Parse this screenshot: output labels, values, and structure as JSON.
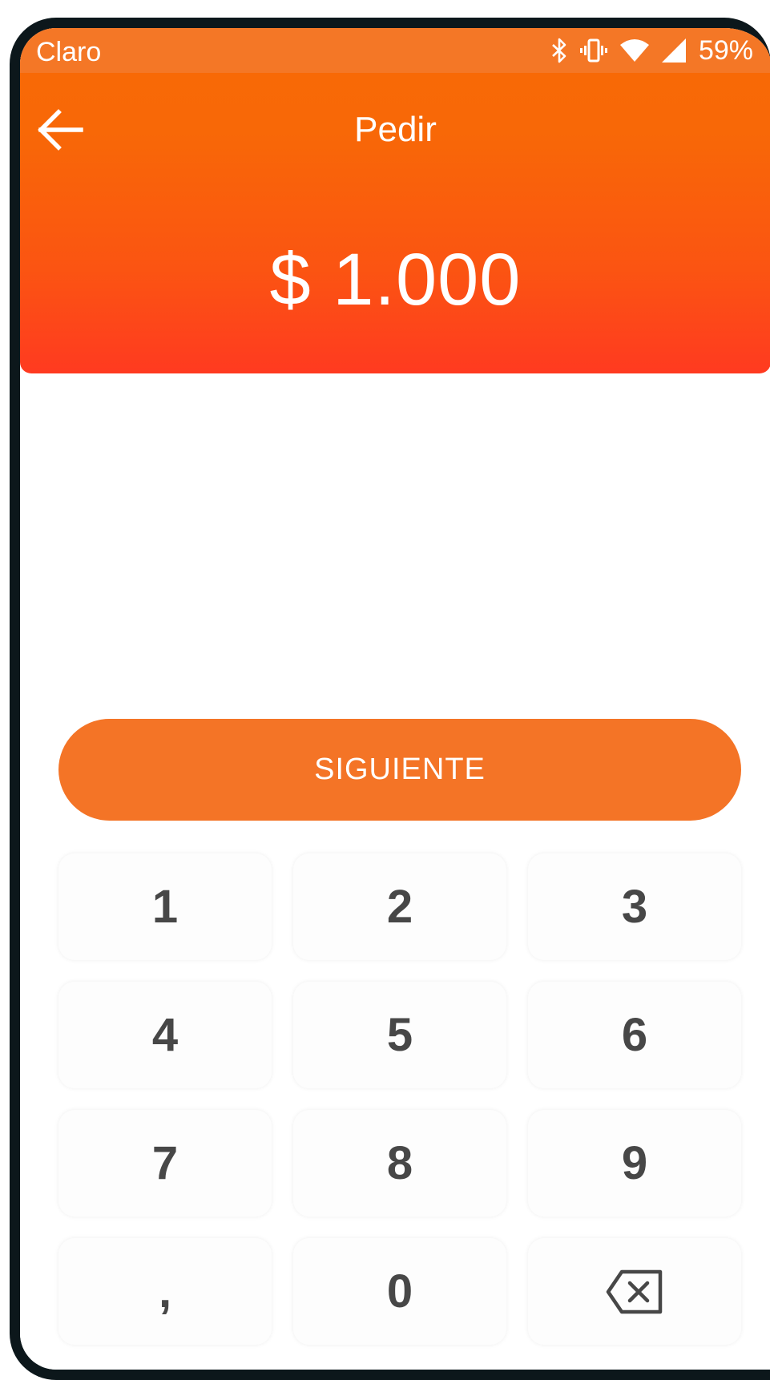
{
  "status_bar": {
    "carrier": "Claro",
    "battery": "59%",
    "icons": [
      "bluetooth-icon",
      "vibrate-icon",
      "wifi-icon",
      "signal-icon"
    ]
  },
  "header": {
    "title": "Pedir",
    "amount": "$ 1.000",
    "back_icon": "arrow-left-icon"
  },
  "actions": {
    "next_label": "SIGUIENTE"
  },
  "keypad": {
    "keys": [
      "1",
      "2",
      "3",
      "4",
      "5",
      "6",
      "7",
      "8",
      "9",
      ",",
      "0"
    ],
    "backspace_icon": "backspace-icon"
  },
  "colors": {
    "status_bar": "#f47726",
    "header_top": "#f86a06",
    "header_bottom": "#ff3a20",
    "button": "#f47426",
    "key_text": "#474747"
  }
}
